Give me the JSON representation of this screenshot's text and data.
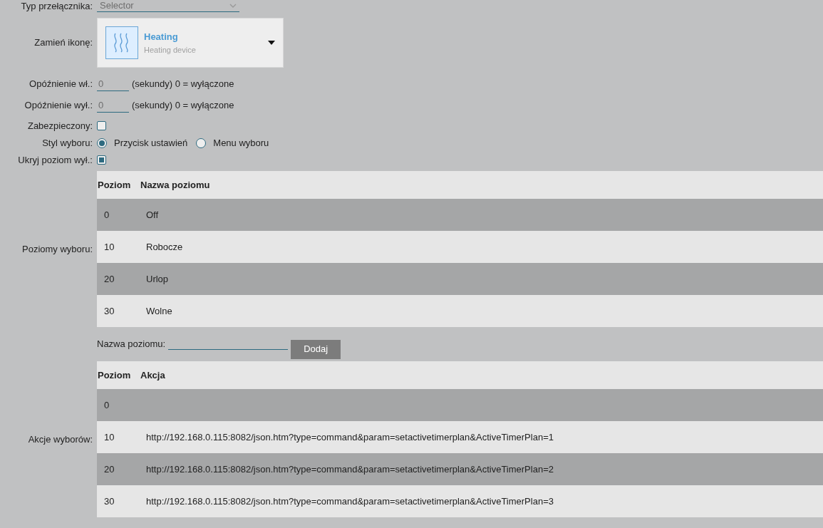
{
  "switch_type": {
    "label": "Typ przełącznika:",
    "placeholder": "Selector"
  },
  "icon": {
    "label": "Zamień ikonę:",
    "title": "Heating",
    "subtitle": "Heating device"
  },
  "delays": [
    {
      "label": "Opóźnienie wł.:",
      "placeholder": "0",
      "hint": "(sekundy) 0 = wyłączone"
    },
    {
      "label": "Opóźnienie wył.:",
      "placeholder": "0",
      "hint": "(sekundy) 0 = wyłączone"
    }
  ],
  "protected": {
    "label": "Zabezpieczony:",
    "checked": false
  },
  "selector_style": {
    "label": "Styl wyboru:",
    "options": [
      {
        "label": "Przycisk ustawień",
        "selected": true
      },
      {
        "label": "Menu wyboru",
        "selected": false
      }
    ]
  },
  "hide_off": {
    "label": "Ukryj poziom wył.:",
    "checked": true
  },
  "levels": {
    "label": "Poziomy wyboru:",
    "columns": [
      "Poziom",
      "Nazwa poziomu"
    ],
    "rows": [
      [
        "0",
        "Off"
      ],
      [
        "10",
        "Robocze"
      ],
      [
        "20",
        "Urlop"
      ],
      [
        "30",
        "Wolne"
      ]
    ]
  },
  "add_level": {
    "label": "Nazwa poziomu:",
    "button": "Dodaj"
  },
  "actions": {
    "label": "Akcje wyborów:",
    "columns": [
      "Poziom",
      "Akcja"
    ],
    "rows": [
      [
        "0",
        ""
      ],
      [
        "10",
        "http://192.168.0.115:8082/json.htm?type=command&param=setactivetimerplan&ActiveTimerPlan=1"
      ],
      [
        "20",
        "http://192.168.0.115:8082/json.htm?type=command&param=setactivetimerplan&ActiveTimerPlan=2"
      ],
      [
        "30",
        "http://192.168.0.115:8082/json.htm?type=command&param=setactivetimerplan&ActiveTimerPlan=3"
      ]
    ]
  }
}
